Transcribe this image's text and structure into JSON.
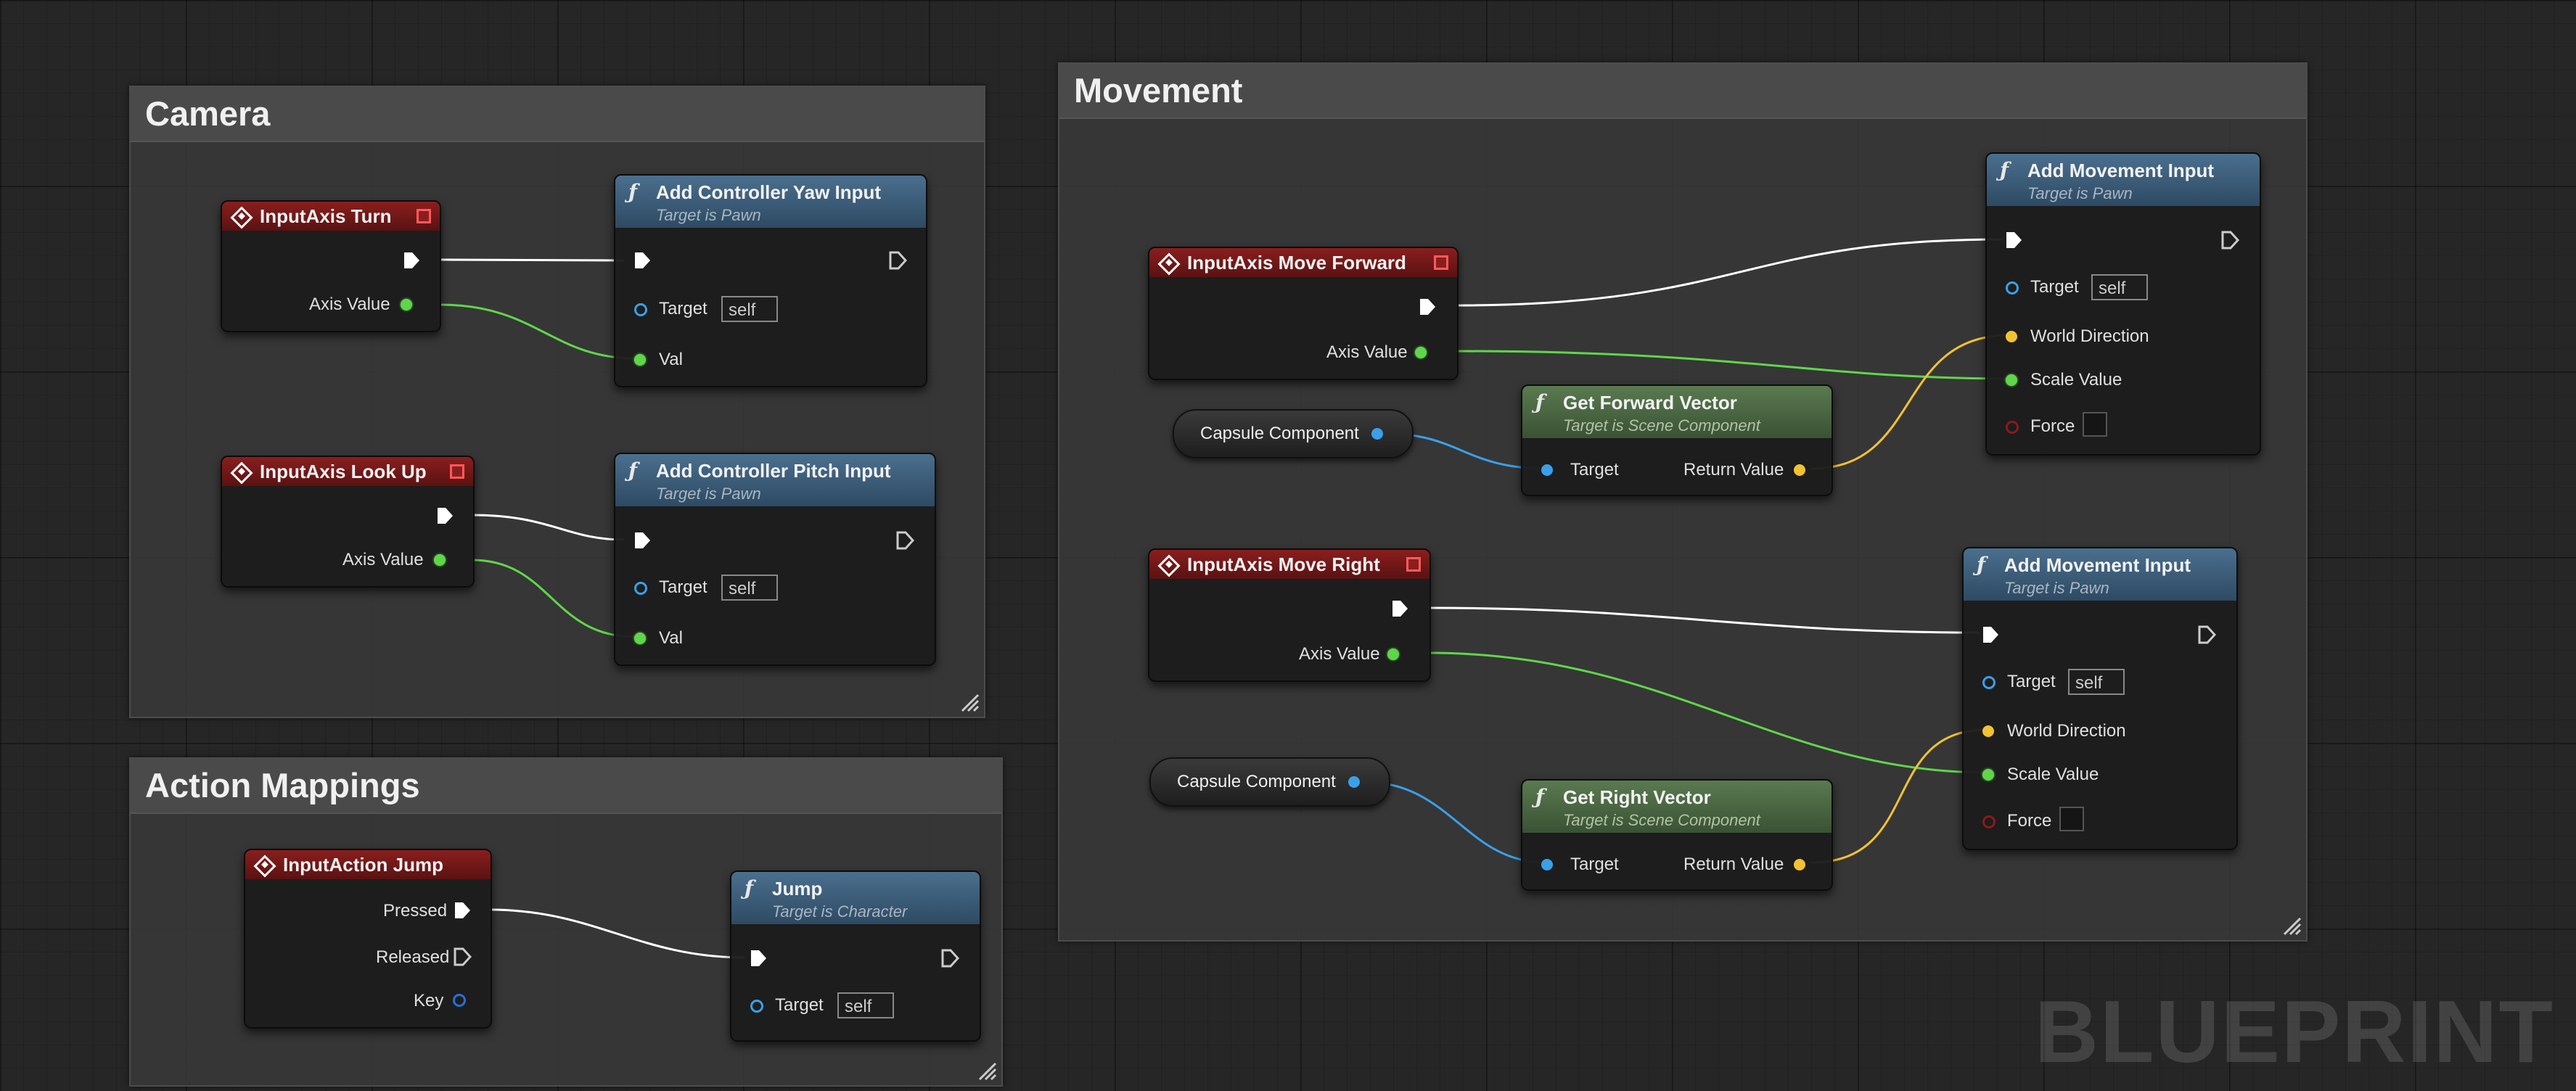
{
  "comments": {
    "camera": "Camera",
    "action_mappings": "Action Mappings",
    "movement": "Movement"
  },
  "nodes": {
    "turn": {
      "title": "InputAxis Turn",
      "axis_value": "Axis Value"
    },
    "look_up": {
      "title": "InputAxis Look Up",
      "axis_value": "Axis Value"
    },
    "add_yaw": {
      "title": "Add Controller Yaw Input",
      "subtitle": "Target is Pawn",
      "target": "Target",
      "target_value": "self",
      "val": "Val"
    },
    "add_pitch": {
      "title": "Add Controller Pitch Input",
      "subtitle": "Target is Pawn",
      "target": "Target",
      "target_value": "self",
      "val": "Val"
    },
    "jump_event": {
      "title": "InputAction Jump",
      "pressed": "Pressed",
      "released": "Released",
      "key": "Key"
    },
    "jump": {
      "title": "Jump",
      "subtitle": "Target is Character",
      "target": "Target",
      "target_value": "self"
    },
    "move_forward": {
      "title": "InputAxis Move Forward",
      "axis_value": "Axis Value"
    },
    "move_right": {
      "title": "InputAxis Move Right",
      "axis_value": "Axis Value"
    },
    "capsule1": {
      "label": "Capsule Component"
    },
    "capsule2": {
      "label": "Capsule Component"
    },
    "get_forward": {
      "title": "Get Forward Vector",
      "subtitle": "Target is Scene Component",
      "target": "Target",
      "return_value": "Return Value"
    },
    "get_right": {
      "title": "Get Right Vector",
      "subtitle": "Target is Scene Component",
      "target": "Target",
      "return_value": "Return Value"
    },
    "add_move1": {
      "title": "Add Movement Input",
      "subtitle": "Target is Pawn",
      "target": "Target",
      "target_value": "self",
      "world_direction": "World Direction",
      "scale_value": "Scale Value",
      "force": "Force"
    },
    "add_move2": {
      "title": "Add Movement Input",
      "subtitle": "Target is Pawn",
      "target": "Target",
      "target_value": "self",
      "world_direction": "World Direction",
      "scale_value": "Scale Value",
      "force": "Force"
    }
  },
  "watermark": "BLUEPRINT",
  "colors": {
    "exec_wire": "#ffffff",
    "float_wire": "#5fd64a",
    "object_wire": "#3aa0e8",
    "vector_wire": "#f2c232",
    "event_header": "#8a1e1e",
    "function_header": "#4a6f8e",
    "pure_header": "#5a7a50"
  }
}
